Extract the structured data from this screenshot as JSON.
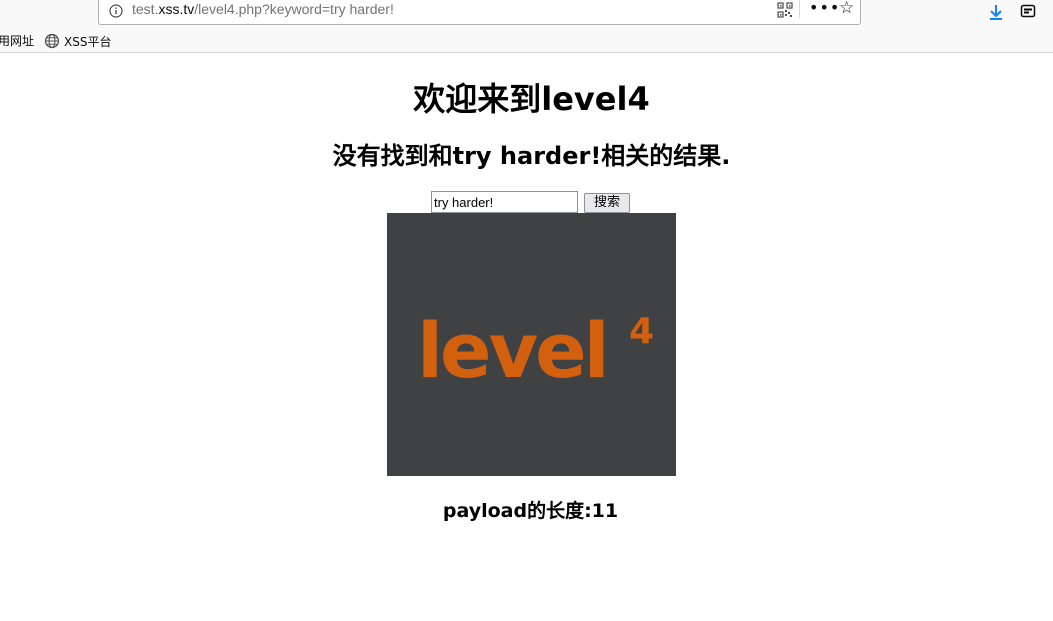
{
  "browser": {
    "url_prefix": "test.",
    "url_host": "xss.tv",
    "url_path": "/level4.php?keyword=try harder!",
    "icons": {
      "info": "info-icon",
      "qr": "qr-code-icon",
      "more": "more-icon",
      "star": "bookmark-star-icon",
      "download": "download-icon",
      "reader": "reader-view-icon"
    }
  },
  "bookmarks": [
    {
      "label": "用网址"
    },
    {
      "label": "XSS平台",
      "icon": "globe-icon"
    }
  ],
  "page": {
    "title": "欢迎来到level4",
    "result_message": "没有找到和try harder!相关的结果.",
    "search": {
      "value": "try harder!",
      "button_label": "搜索"
    },
    "image": {
      "logo_text": "level",
      "logo_superscript": "4",
      "background": "#404143",
      "logo_color": "#d2600f"
    },
    "payload_length": "payload的长度:11"
  }
}
